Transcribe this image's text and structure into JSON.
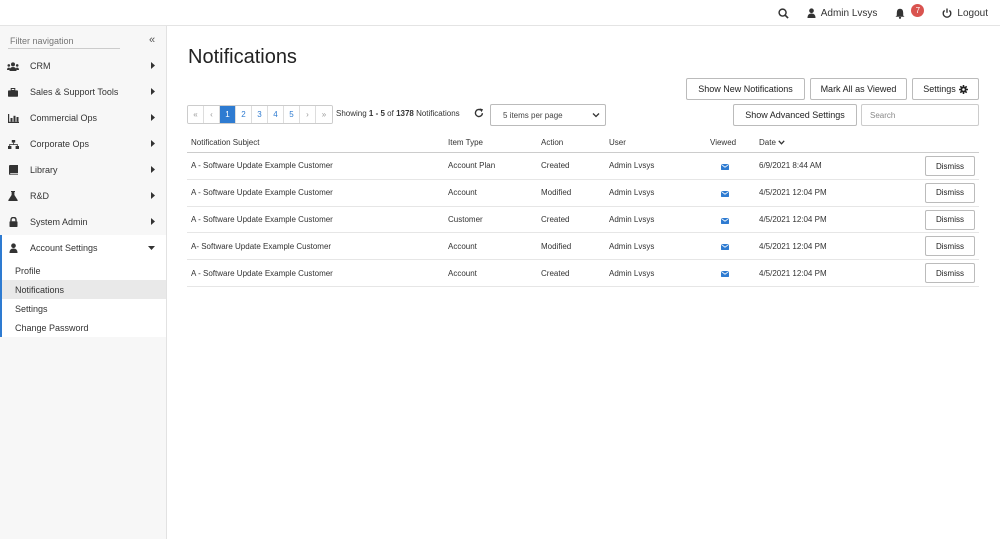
{
  "topbar": {
    "user_name": "Admin Lvsys",
    "notification_count": "7",
    "logout_label": "Logout"
  },
  "sidebar": {
    "filter_placeholder": "Filter navigation",
    "items": [
      {
        "label": "CRM",
        "icon": "users-icon"
      },
      {
        "label": "Sales & Support Tools",
        "icon": "briefcase-icon"
      },
      {
        "label": "Commercial Ops",
        "icon": "bar-chart-icon"
      },
      {
        "label": "Corporate Ops",
        "icon": "sitemap-icon"
      },
      {
        "label": "Library",
        "icon": "book-icon"
      },
      {
        "label": "R&D",
        "icon": "flask-icon"
      },
      {
        "label": "System Admin",
        "icon": "lock-icon"
      }
    ],
    "account_group": {
      "label": "Account Settings",
      "icon": "user-icon",
      "subitems": [
        "Profile",
        "Notifications",
        "Settings",
        "Change Password"
      ],
      "active": "Notifications"
    }
  },
  "main": {
    "title": "Notifications",
    "buttons": {
      "show_new": "Show New Notifications",
      "mark_all": "Mark All as Viewed",
      "settings": "Settings",
      "advanced": "Show Advanced Settings"
    },
    "pager": {
      "first": "«",
      "prev": "‹",
      "pages": [
        "1",
        "2",
        "3",
        "4",
        "5"
      ],
      "next": "›",
      "last": "»",
      "active_page": "1"
    },
    "showing": {
      "prefix": "Showing ",
      "range": "1 - 5",
      "of": " of ",
      "total": "1378",
      "suffix": " Notifications"
    },
    "per_page": "5 items per page",
    "search_placeholder": "Search",
    "table": {
      "headers": {
        "subject": "Notification Subject",
        "item_type": "Item Type",
        "action": "Action",
        "user": "User",
        "viewed": "Viewed",
        "date": "Date"
      },
      "dismiss_label": "Dismiss",
      "rows": [
        {
          "subject": "A - Software Update Example Customer",
          "item_type": "Account Plan",
          "action": "Created",
          "user": "Admin Lvsys",
          "date": "6/9/2021 8:44 AM"
        },
        {
          "subject": "A - Software Update Example Customer",
          "item_type": "Account",
          "action": "Modified",
          "user": "Admin Lvsys",
          "date": "4/5/2021 12:04 PM"
        },
        {
          "subject": "A - Software Update Example Customer",
          "item_type": "Customer",
          "action": "Created",
          "user": "Admin Lvsys",
          "date": "4/5/2021 12:04 PM"
        },
        {
          "subject": "A- Software Update Example Customer",
          "item_type": "Account",
          "action": "Modified",
          "user": "Admin Lvsys",
          "date": "4/5/2021 12:04 PM"
        },
        {
          "subject": "A - Software Update Example Customer",
          "item_type": "Account",
          "action": "Created",
          "user": "Admin Lvsys",
          "date": "4/5/2021 12:04 PM"
        }
      ]
    }
  },
  "colors": {
    "accent": "#2e7bd1",
    "badge": "#d9534f"
  }
}
